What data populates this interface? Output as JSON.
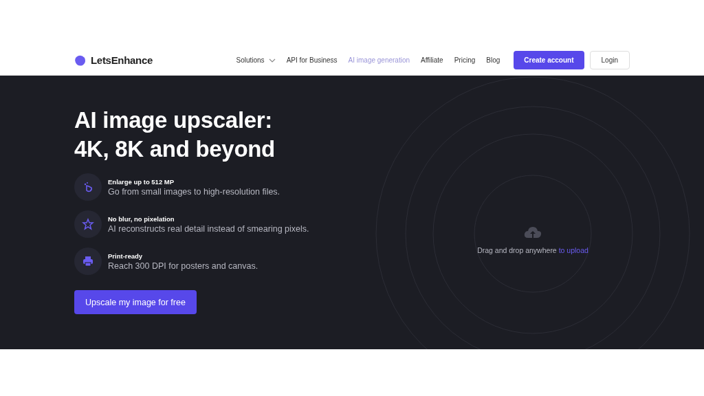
{
  "header": {
    "brand": "LetsEnhance",
    "nav": [
      {
        "label": "Solutions",
        "kind": "dropdown",
        "selected": false
      },
      {
        "label": "API for Business",
        "kind": "link",
        "selected": false
      },
      {
        "label": "AI image generation",
        "kind": "link",
        "selected": true
      },
      {
        "label": "Affiliate",
        "kind": "link",
        "selected": false
      },
      {
        "label": "Pricing",
        "kind": "link",
        "selected": false
      },
      {
        "label": "Blog",
        "kind": "link",
        "selected": false
      }
    ],
    "primary_button": "Create account",
    "secondary_button": "Login"
  },
  "hero": {
    "title_lines": [
      "AI image upscaler:",
      "4K, 8K and beyond"
    ],
    "features": [
      {
        "kind": "enlarge",
        "title": "Enlarge up to 512 MP",
        "text": "Go from small images to high-resolution files."
      },
      {
        "kind": "star",
        "title": "No blur, no pixelation",
        "text": "AI reconstructs real detail instead of smearing pixels."
      },
      {
        "kind": "print",
        "title": "Print-ready",
        "text": "Reach 300 DPI for posters and canvas."
      }
    ],
    "cta": "Upscale my image for free",
    "upload": {
      "text": "Drag and drop anywhere",
      "link": "to upload"
    }
  }
}
